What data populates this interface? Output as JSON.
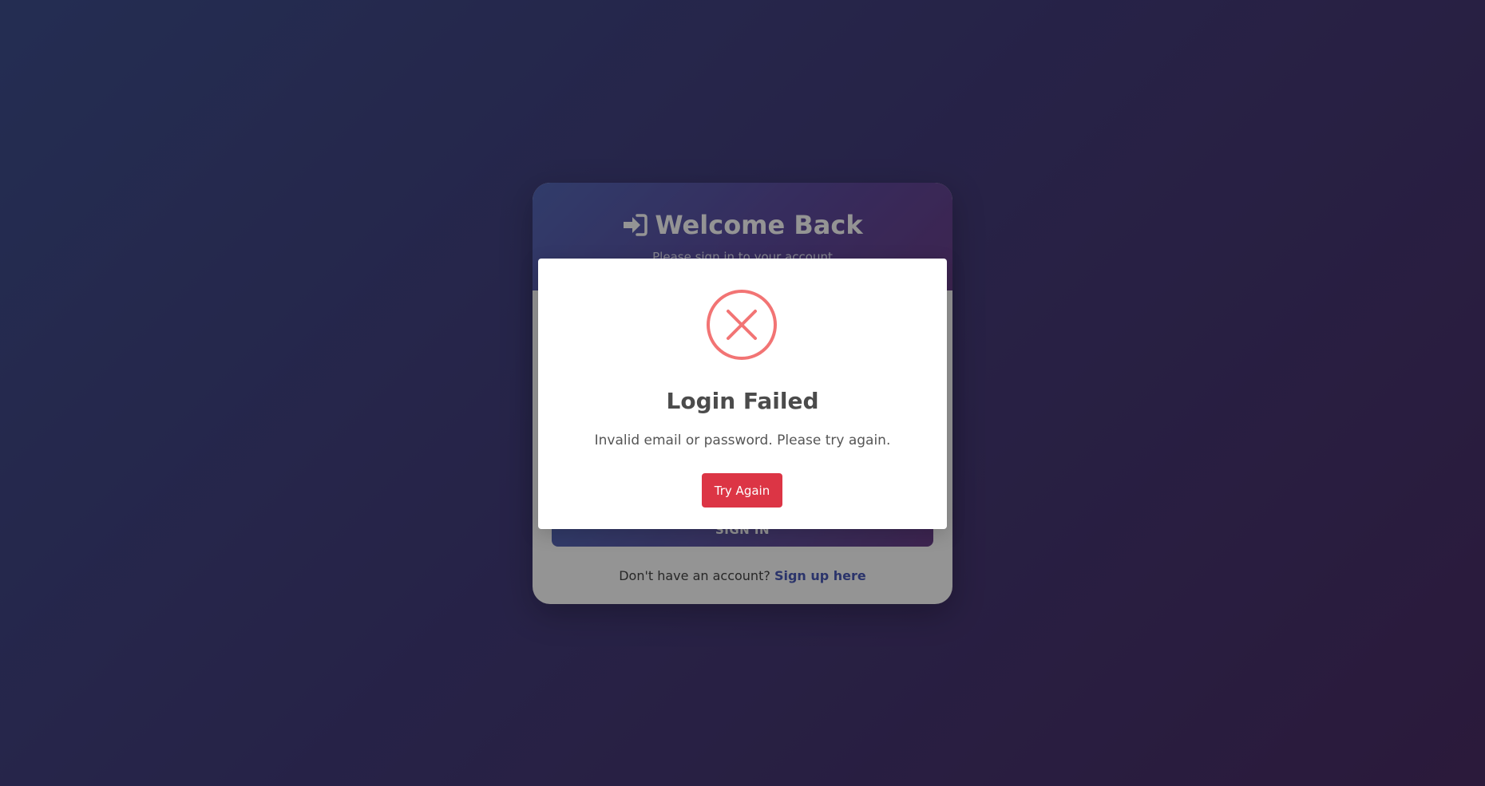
{
  "login_card": {
    "title": "Welcome Back",
    "title_icon": "sign-in-icon",
    "subtitle": "Please sign in to your account",
    "signin_label": "SIGN IN",
    "signup_prompt": "Don't have an account?",
    "signup_link": "Sign up here"
  },
  "modal": {
    "icon": "error-circle-x-icon",
    "title": "Login Failed",
    "message": "Invalid email or password. Please try again.",
    "button_label": "Try Again"
  },
  "colors": {
    "error": "#f27474",
    "danger_button": "#dc3545",
    "link": "#4a5ab8"
  }
}
